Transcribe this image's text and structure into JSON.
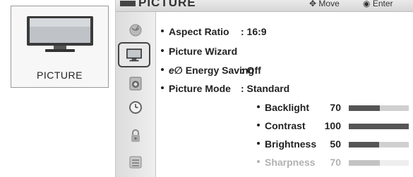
{
  "preview_card": {
    "label": "PICTURE"
  },
  "header": {
    "title": "PICTURE",
    "move_hint": "Move",
    "enter_hint": "Enter"
  },
  "sidebar": {
    "items": [
      {
        "icon": "satellite-dish-icon"
      },
      {
        "icon": "picture-tv-icon",
        "selected": true
      },
      {
        "icon": "speaker-icon"
      },
      {
        "icon": "clock-icon"
      },
      {
        "icon": "lock-icon"
      },
      {
        "icon": "options-icon"
      }
    ]
  },
  "menu": {
    "aspect_ratio": {
      "label": "Aspect Ratio",
      "value": ": 16:9"
    },
    "picture_wizard": {
      "label": "Picture Wizard"
    },
    "energy_saving": {
      "eco_mark": "e∅",
      "label": "Energy Saving",
      "value": ": Off"
    },
    "picture_mode": {
      "label": "Picture Mode",
      "value": ": Standard"
    }
  },
  "adjustments": {
    "backlight": {
      "label": "Backlight",
      "value": "70",
      "level": 0.52
    },
    "contrast": {
      "label": "Contrast",
      "value": "100",
      "level": 1.0
    },
    "brightness": {
      "label": "Brightness",
      "value": "50",
      "level": 0.5
    },
    "sharpness": {
      "label": "Sharpness",
      "value": "70",
      "level": 0.52
    }
  },
  "colors": {
    "bar_fill": "#555555",
    "bar_track": "#d0d0d0",
    "header_bg": "#dddddd"
  }
}
